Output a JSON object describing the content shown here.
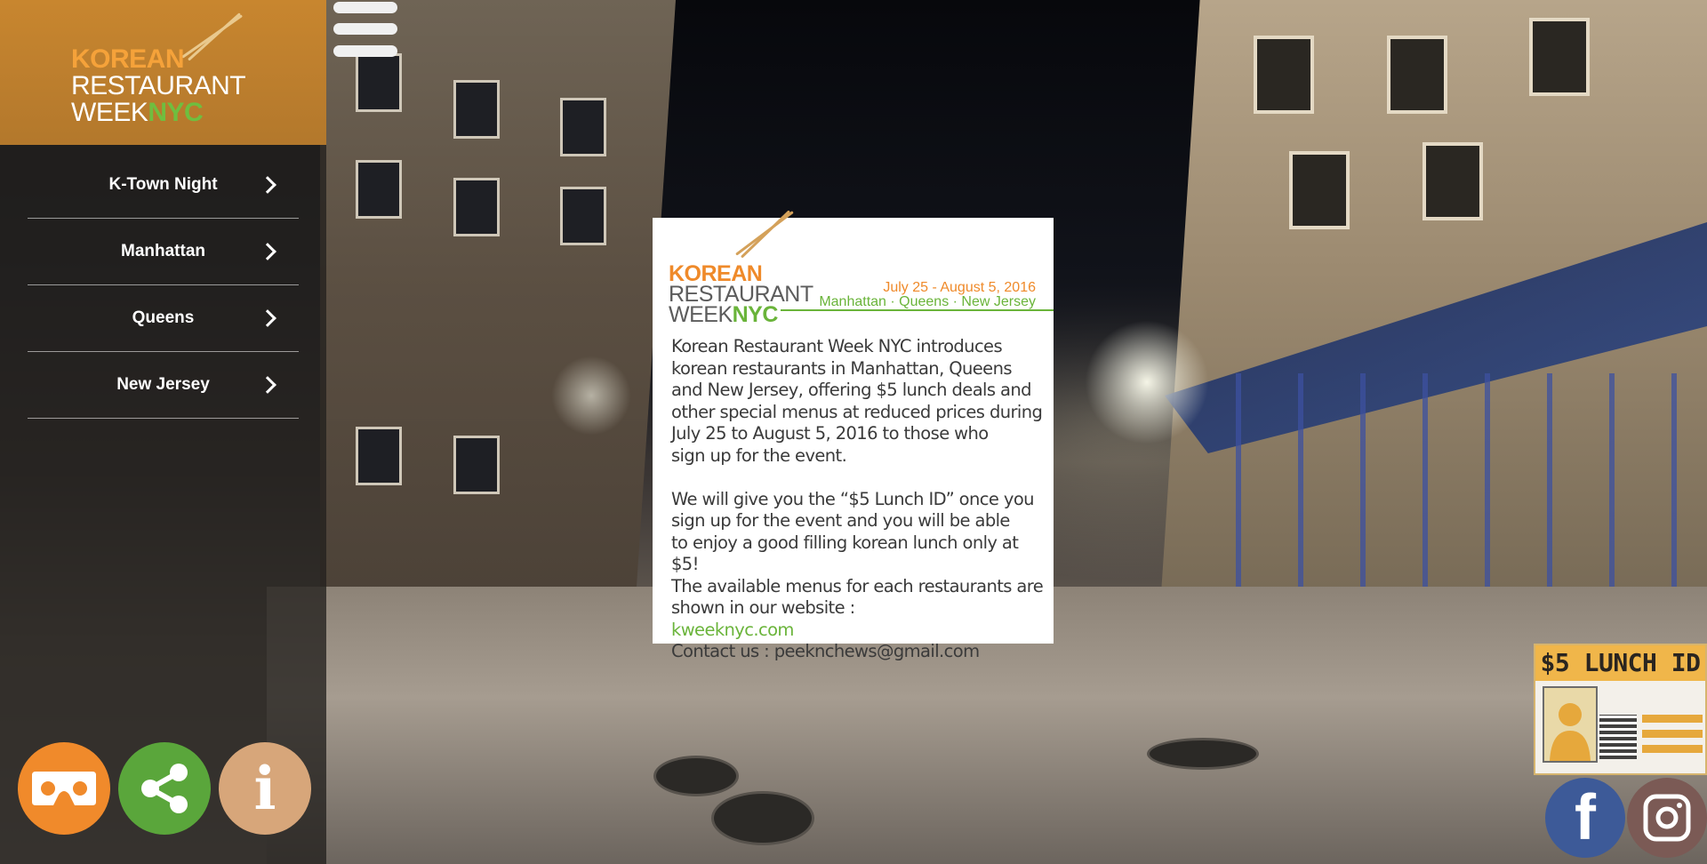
{
  "sidebar": {
    "logo": {
      "line1": "KOREAN",
      "line2": "RESTAURANT",
      "line3a": "WEEK",
      "line3b": "NYC"
    },
    "menu": [
      {
        "label": "K-Town Night"
      },
      {
        "label": "Manhattan"
      },
      {
        "label": "Queens"
      },
      {
        "label": "New Jersey"
      }
    ],
    "buttons": {
      "vr": "vr-headset-icon",
      "share": "share-icon",
      "info": "i"
    }
  },
  "card": {
    "logo": {
      "line1": "KOREAN",
      "line2": "RESTAURANT",
      "line3a": "WEEK",
      "line3b": "NYC"
    },
    "dates": "July 25 - August 5, 2016",
    "places": "Manhattan · Queens · New Jersey",
    "body": [
      "Korean Restaurant Week NYC introduces",
      "korean restaurants in Manhattan, Queens",
      "and New Jersey, offering $5 lunch deals and",
      "other special menus at reduced prices during",
      "July 25 to August 5, 2016 to those who",
      "sign up for the event."
    ],
    "body2": [
      "We will give you the “$5 Lunch ID” once you",
      "sign up for the event and you will be able",
      "to enjoy a good filling korean lunch only at $5!",
      "The available menus for each restaurants are",
      "shown in our website :"
    ],
    "link": "kweeknyc.com",
    "contact": "Contact us : peeknchews@gmail.com"
  },
  "lunch_id": {
    "title": "$5 LUNCH ID"
  },
  "social": {
    "facebook": "f",
    "instagram": "instagram-icon"
  },
  "colors": {
    "accent_orange": "#ef8a2a",
    "accent_green": "#6ab43a",
    "logo_bg": "#c8862f"
  }
}
